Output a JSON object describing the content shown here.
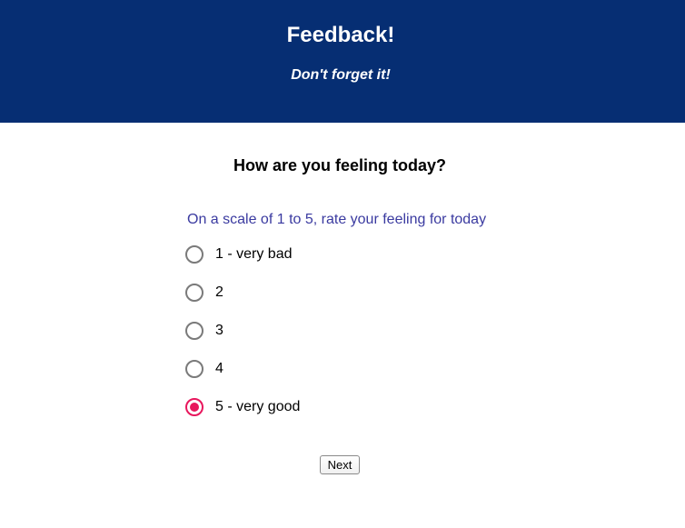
{
  "header": {
    "title": "Feedback!",
    "subtitle": "Don't forget it!",
    "background_color": "#062e73"
  },
  "question": {
    "title": "How are you feeling today?",
    "scale_label": "On a scale of 1 to 5, rate your feeling for today",
    "options": [
      {
        "label": "1 - very bad",
        "checked": false
      },
      {
        "label": "2",
        "checked": false
      },
      {
        "label": "3",
        "checked": false
      },
      {
        "label": "4",
        "checked": false
      },
      {
        "label": "5 - very good",
        "checked": true
      }
    ],
    "selected_color": "#e8175d"
  },
  "actions": {
    "next_label": "Next"
  }
}
